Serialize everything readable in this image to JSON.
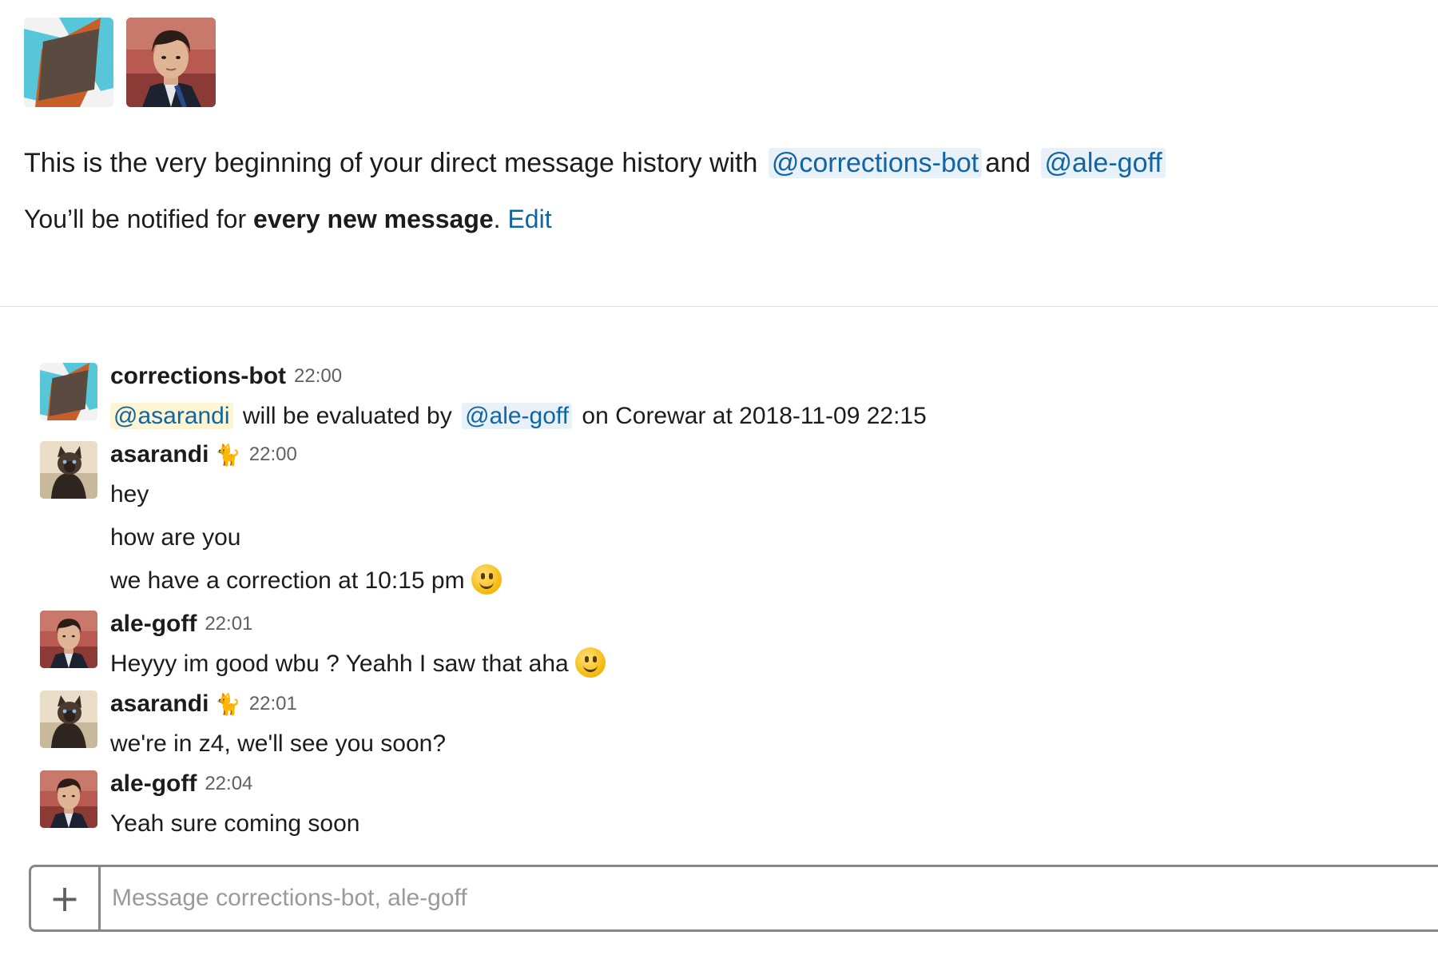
{
  "intro": {
    "text_before": "This is the very beginning of your direct message history with",
    "mention_1": "@corrections-bot",
    "conjunction": "and",
    "mention_2": "@ale-goff",
    "notify_prefix": "You’ll be notified for",
    "notify_bold": "every new message",
    "notify_suffix": ".",
    "edit_link": "Edit"
  },
  "colors": {
    "link": "#1264a3",
    "mention_bg": "#e8f1f8",
    "self_mention_bg": "#fdf5d4",
    "bot_teal": "#56c6d8",
    "bot_orange": "#c85f2a",
    "bot_dark": "#5a4a3f"
  },
  "messages": [
    {
      "sender": "corrections-bot",
      "avatar": "corrections-bot-logo",
      "time": "22:00",
      "status_emoji": "",
      "lines": [
        {
          "mention_self": "@asarandi",
          "text_1": "will be evaluated by",
          "mention_2": "@ale-goff",
          "text_2": "on Corewar at 2018-11-09 22:15"
        }
      ]
    },
    {
      "sender": "asarandi",
      "avatar": "cat-photo",
      "time": "22:00",
      "status_emoji": "🐈",
      "lines": [
        "hey",
        "how are you",
        "we have a correction at 10:15 pm"
      ],
      "trailing_emoji": "slightly-smiling-face"
    },
    {
      "sender": "ale-goff",
      "avatar": "person-photo",
      "time": "22:01",
      "status_emoji": "",
      "lines": [
        "Heyyy im good wbu ? Yeahh I saw that aha"
      ],
      "trailing_emoji": "slightly-smiling-face"
    },
    {
      "sender": "asarandi",
      "avatar": "cat-photo",
      "time": "22:01",
      "status_emoji": "🐈",
      "lines": [
        "we're in z4, we'll see you soon?"
      ]
    },
    {
      "sender": "ale-goff",
      "avatar": "person-photo",
      "time": "22:04",
      "status_emoji": "",
      "lines": [
        "Yeah sure coming soon"
      ]
    }
  ],
  "composer": {
    "plus_icon": "+",
    "placeholder": "Message corrections-bot, ale-goff",
    "value": ""
  }
}
